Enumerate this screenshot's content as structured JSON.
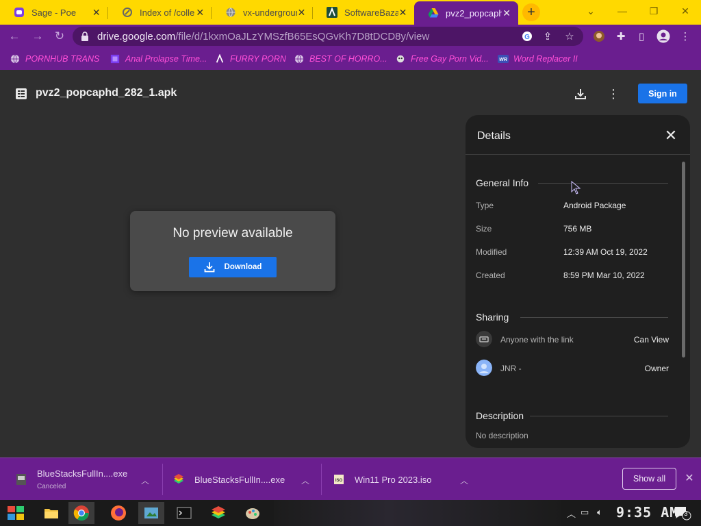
{
  "tabs": [
    {
      "title": "Sage - Poe",
      "icon": "poe-icon",
      "active": false
    },
    {
      "title": "Index of /colle",
      "icon": "folder-icon",
      "active": false
    },
    {
      "title": "vx-undergroun",
      "icon": "globe-icon",
      "active": false
    },
    {
      "title": "SoftwareBazaa",
      "icon": "software-bazaar-icon",
      "active": false
    },
    {
      "title": "pvz2_popcaphd",
      "icon": "google-drive-icon",
      "active": true
    }
  ],
  "address_bar": {
    "domain": "drive.google.com",
    "path": "/file/d/1kxmOaJLzYMSzfB65EsQGvKh7D8tDCD8y/view"
  },
  "bookmarks": [
    {
      "label": "PORNHUB TRANS",
      "icon": "globe-icon"
    },
    {
      "label": "Anal Prolapse Time...",
      "icon": "bookmark-icon"
    },
    {
      "label": "FURRY PORN",
      "icon": "software-bazaar-icon"
    },
    {
      "label": "BEST OF HORRO...",
      "icon": "globe-icon"
    },
    {
      "label": "Free Gay Porn Vid...",
      "icon": "creature-icon"
    },
    {
      "label": "Word Replacer II",
      "icon": "word-replacer-icon"
    }
  ],
  "file": {
    "name": "pvz2_popcaphd_282_1.apk",
    "sign_in_label": "Sign in"
  },
  "preview": {
    "message": "No preview available",
    "download_label": "Download"
  },
  "details": {
    "title": "Details",
    "general_info": {
      "heading": "General Info",
      "rows": [
        {
          "label": "Type",
          "value": "Android Package"
        },
        {
          "label": "Size",
          "value": "756 MB"
        },
        {
          "label": "Modified",
          "value": "12:39 AM Oct 19, 2022"
        },
        {
          "label": "Created",
          "value": "8:59 PM Mar 10, 2022"
        }
      ]
    },
    "sharing": {
      "heading": "Sharing",
      "entries": [
        {
          "name": "Anyone with the link",
          "role": "Can View",
          "icon": "link-icon"
        },
        {
          "name": "JNR -",
          "role": "Owner",
          "icon": "avatar-icon"
        }
      ]
    },
    "description": {
      "heading": "Description",
      "text": "No description"
    }
  },
  "downloads": [
    {
      "name": "BlueStacksFullIn....exe",
      "status": "Canceled",
      "icon": "installer-icon"
    },
    {
      "name": "BlueStacksFullIn....exe",
      "status": "",
      "icon": "bluestacks-icon"
    },
    {
      "name": "Win11 Pro 2023.iso",
      "status": "",
      "icon": "iso-icon"
    }
  ],
  "shelf": {
    "show_all_label": "Show all"
  },
  "taskbar": {
    "clock": "9:35 AM",
    "notification_count": "3"
  },
  "colors": {
    "tab_strip": "#ffd900",
    "browser_theme": "#6a1e8f",
    "bookmark_text": "#ff4fd8",
    "drive_blue": "#1a73e8",
    "viewer_bg": "#2f2f2f",
    "panel_bg": "#1f1f1f"
  }
}
